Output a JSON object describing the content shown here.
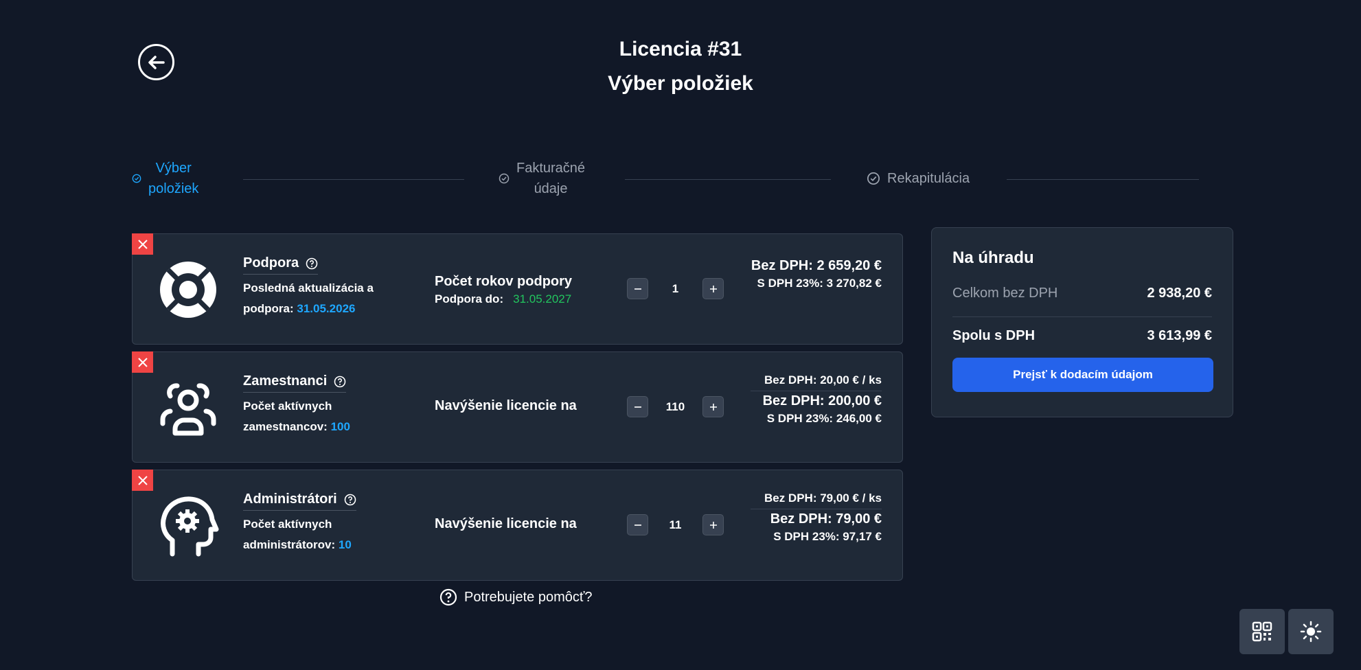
{
  "header": {
    "title": "Licencia #31",
    "subtitle": "Výber položiek"
  },
  "steps": [
    {
      "label_line1": "Výber",
      "label_line2": "položiek",
      "state": "active"
    },
    {
      "label_line1": "Fakturačné",
      "label_line2": "údaje",
      "state": "inactive"
    },
    {
      "label_line1": "Rekapitulácia",
      "label_line2": "",
      "state": "inactive"
    }
  ],
  "items": [
    {
      "name": "Podpora",
      "desc_text": "Posledná aktualizácia a podpora:",
      "desc_value": "31.05.2026",
      "mid_label": "Počet rokov podpory",
      "mid_sub_label": "Podpora do:",
      "mid_sub_value": "31.05.2027",
      "quantity": "1",
      "price_no_vat": "Bez DPH: 2 659,20 €",
      "price_vat": "S DPH 23%: 3 270,82 €"
    },
    {
      "name": "Zamestnanci",
      "desc_text": "Počet aktívnych zamestnancov:",
      "desc_value": "100",
      "mid_label": "Navýšenie licencie na",
      "quantity": "110",
      "unit_price": "Bez DPH: 20,00 € / ks",
      "price_no_vat": "Bez DPH: 200,00 €",
      "price_vat": "S DPH 23%: 246,00 €"
    },
    {
      "name": "Administrátori",
      "desc_text": "Počet aktívnych administrátorov:",
      "desc_value": "10",
      "mid_label": "Navýšenie licencie na",
      "quantity": "11",
      "unit_price": "Bez DPH: 79,00 € / ks",
      "price_no_vat": "Bez DPH: 79,00 €",
      "price_vat": "S DPH 23%: 97,17 €"
    }
  ],
  "help": {
    "label": "Potrebujete pomôcť?"
  },
  "summary": {
    "title": "Na úhradu",
    "total_no_vat_label": "Celkom bez DPH",
    "total_no_vat_value": "2 938,20 €",
    "total_vat_label": "Spolu s DPH",
    "total_vat_value": "3 613,99 €",
    "cta_label": "Prejsť k dodacím údajom"
  },
  "colors": {
    "background": "#111827",
    "card": "#1f2937",
    "accent": "#1ea7ff",
    "primary_button": "#2563eb",
    "danger": "#ef4444",
    "success": "#22c55e"
  },
  "icons": [
    "back-arrow-icon",
    "check-circle-icon",
    "lifebuoy-icon",
    "users-icon",
    "head-gear-icon",
    "help-icon",
    "minus-icon",
    "plus-icon",
    "close-icon",
    "qr-code-icon",
    "sun-icon"
  ]
}
